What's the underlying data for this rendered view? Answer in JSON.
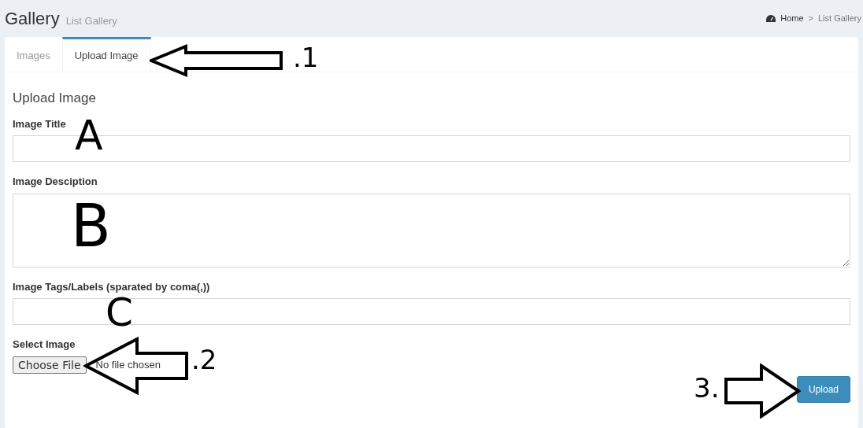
{
  "header": {
    "title": "Gallery",
    "subtitle": "List Gallery"
  },
  "breadcrumb": [
    {
      "label": "Home",
      "kind": "home"
    },
    {
      "label": "List Gallery",
      "kind": "page"
    }
  ],
  "breadcrumb_separator": ">",
  "tabs": [
    {
      "label": "Images",
      "selected": false
    },
    {
      "label": "Upload Image",
      "selected": true
    }
  ],
  "form": {
    "heading": "Upload Image",
    "fields": [
      {
        "label": "Image Title",
        "kind": "text"
      },
      {
        "label": "Image Desciption",
        "kind": "textarea"
      },
      {
        "label": "Image Tags/Labels (sparated by coma(,))",
        "kind": "text"
      },
      {
        "label": "Select Image",
        "kind": "file",
        "button": "Choose File",
        "status": "No file chosen"
      }
    ],
    "submit": "Upload"
  },
  "annotations": [
    ".1",
    "A",
    "B",
    "C",
    ".2",
    "3."
  ]
}
